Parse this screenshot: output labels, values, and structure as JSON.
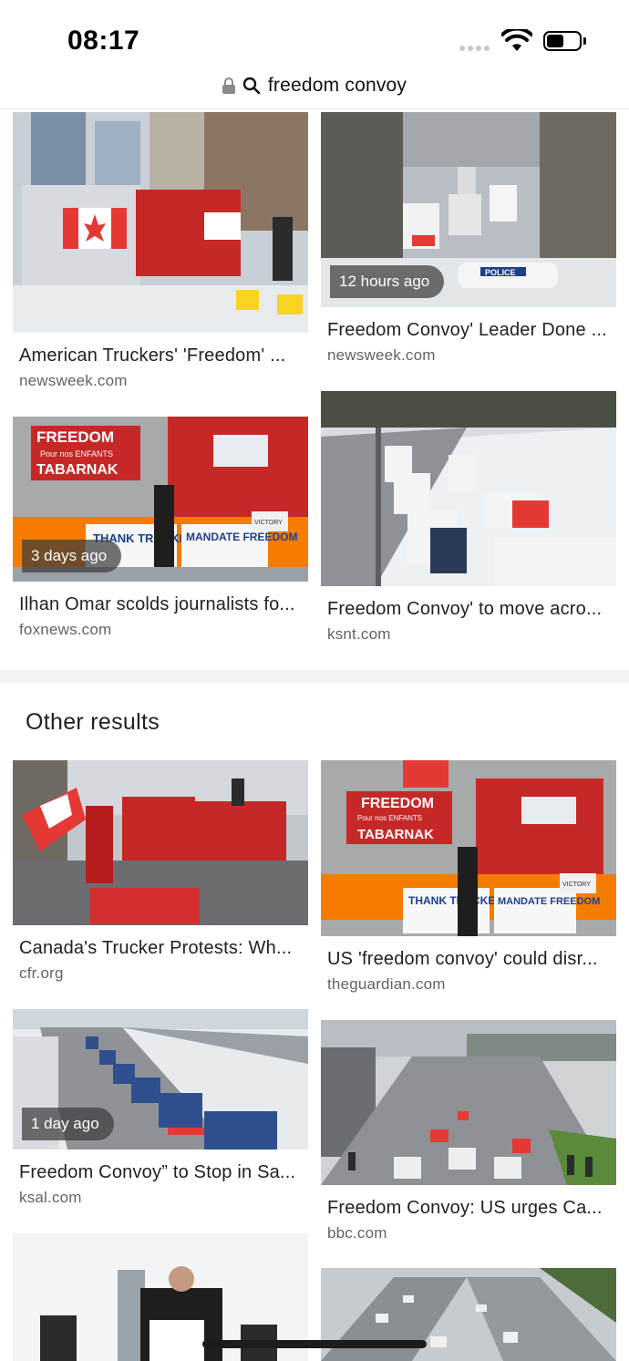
{
  "status_bar": {
    "time": "08:17"
  },
  "url_bar": {
    "query": "freedom convoy"
  },
  "top_results": [
    {
      "title": "American Truckers' 'Freedom' ...",
      "source": "newsweek.com",
      "badge": ""
    },
    {
      "title": "Freedom Convoy' Leader Done ...",
      "source": "newsweek.com",
      "badge": "12 hours ago"
    },
    {
      "title": "Ilhan Omar scolds journalists fo...",
      "source": "foxnews.com",
      "badge": "3 days ago"
    },
    {
      "title": "Freedom Convoy' to move acro...",
      "source": "ksnt.com",
      "badge": ""
    }
  ],
  "other_results": {
    "heading": "Other results",
    "items": [
      {
        "title": "Canada's Trucker Protests: Wh...",
        "source": "cfr.org",
        "badge": ""
      },
      {
        "title": "US 'freedom convoy' could disr...",
        "source": "theguardian.com",
        "badge": ""
      },
      {
        "title": "Freedom Convoy” to Stop in Sa...",
        "source": "ksal.com",
        "badge": "1 day ago"
      },
      {
        "title": "Freedom Convoy: US urges Ca...",
        "source": "bbc.com",
        "badge": ""
      }
    ]
  },
  "image_text": {
    "freedom_sign": "FREEDOM",
    "pour_nos_enfants": "Pour nos ENFANTS",
    "tabarnak": "TABARNAK",
    "thank_truckers": "THANK TRUCKERS",
    "mandate_freedom": "MANDATE FREEDOM",
    "victory": "VICTORY",
    "police": "POLICE"
  },
  "colors": {
    "accent": "#1a73e8",
    "badge_bg": "#3c3c3c",
    "source_text": "#5f6368"
  }
}
